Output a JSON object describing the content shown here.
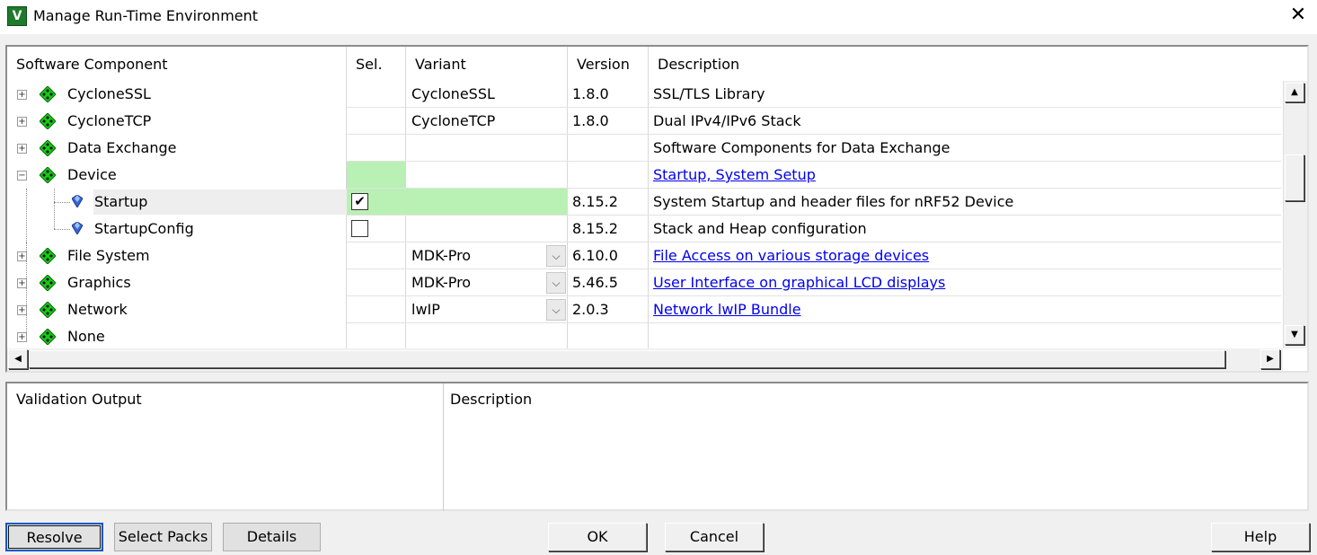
{
  "window": {
    "title": "Manage Run-Time Environment",
    "close_glyph": "✕",
    "app_icon_letter": "V"
  },
  "grid": {
    "headers": {
      "component": "Software Component",
      "sel": "Sel.",
      "variant": "Variant",
      "version": "Version",
      "description": "Description"
    },
    "rows": [
      {
        "name": "CycloneSSL",
        "variant": "CycloneSSL",
        "version": "1.8.0",
        "description": "SSL/TLS Library"
      },
      {
        "name": "CycloneTCP",
        "variant": "CycloneTCP",
        "version": "1.8.0",
        "description": "Dual IPv4/IPv6 Stack"
      },
      {
        "name": "Data Exchange",
        "variant": "",
        "version": "",
        "description": "Software Components for Data Exchange"
      },
      {
        "name": "Device",
        "variant": "",
        "version": "",
        "description": "Startup, System Setup"
      },
      {
        "name": "Startup",
        "variant": "",
        "version": "8.15.2",
        "description": "System Startup and header files for nRF52 Device",
        "checked": true
      },
      {
        "name": "StartupConfig",
        "variant": "",
        "version": "8.15.2",
        "description": "Stack and Heap configuration",
        "checked": false
      },
      {
        "name": "File System",
        "variant": "MDK-Pro",
        "version": "6.10.0",
        "description": "File Access on various storage devices"
      },
      {
        "name": "Graphics",
        "variant": "MDK-Pro",
        "version": "5.46.5",
        "description": "User Interface on graphical LCD displays"
      },
      {
        "name": "Network",
        "variant": "lwIP",
        "version": "2.0.3",
        "description": "Network lwIP Bundle"
      },
      {
        "name": "None",
        "variant": "",
        "version": "",
        "description": ""
      }
    ],
    "expander_plus": "+",
    "expander_minus": "−",
    "check_glyph": "✔",
    "dropdown_glyph": "⌵"
  },
  "scrollbar": {
    "up": "▲",
    "down": "▼",
    "left": "◀",
    "right": "▶"
  },
  "bottom_panel": {
    "validation_header": "Validation Output",
    "description_header": "Description"
  },
  "buttons": {
    "resolve": "Resolve",
    "select_packs": "Select Packs",
    "details": "Details",
    "ok": "OK",
    "cancel": "Cancel",
    "help": "Help"
  },
  "colors": {
    "selection_green": "#b9f0b3",
    "link_blue": "#0000ee",
    "node_green": "#18c818"
  }
}
